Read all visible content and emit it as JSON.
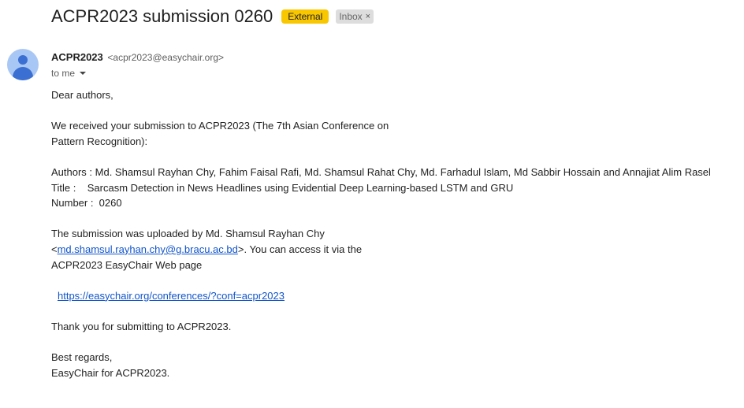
{
  "email": {
    "subject": "ACPR2023 submission 0260",
    "labels": {
      "external": "External",
      "inbox": "Inbox",
      "inbox_remove": "×"
    },
    "sender": {
      "name": "ACPR2023",
      "email": "<acpr2023@easychair.org>"
    },
    "recipient": "to me",
    "body": {
      "greeting": "Dear authors,",
      "received_line1": "We received your submission to ACPR2023 (The 7th Asian Conference on",
      "received_line2": "Pattern Recognition):",
      "authors": "Authors : Md. Shamsul Rayhan Chy, Fahim Faisal Rafi, Md. Shamsul Rahat Chy, Md. Farhadul Islam, Md Sabbir Hossain and Annajiat Alim Rasel",
      "title": "Title :    Sarcasm Detection in News Headlines using Evidential Deep Learning-based LSTM and GRU",
      "number": "Number :  0260",
      "uploaded_line1": "The submission was uploaded by Md. Shamsul Rayhan Chy",
      "uploaded_prefix": "<",
      "uploader_email": "md.shamsul.rayhan.chy@g.bracu.ac.bd",
      "uploaded_suffix": ">. You can access it via the",
      "uploaded_line3": "ACPR2023 EasyChair Web page",
      "easychair_link": "https://easychair.org/conferences/?conf=acpr2023",
      "thanks": "Thank you for submitting to ACPR2023.",
      "regards": "Best regards,",
      "signature": "EasyChair for ACPR2023."
    }
  },
  "colors": {
    "external_label": "#f9c700",
    "inbox_label": "#dddddd",
    "avatar_bg": "#a9c7f5",
    "avatar_fg": "#3b6fd1",
    "link": "#1155cc"
  }
}
